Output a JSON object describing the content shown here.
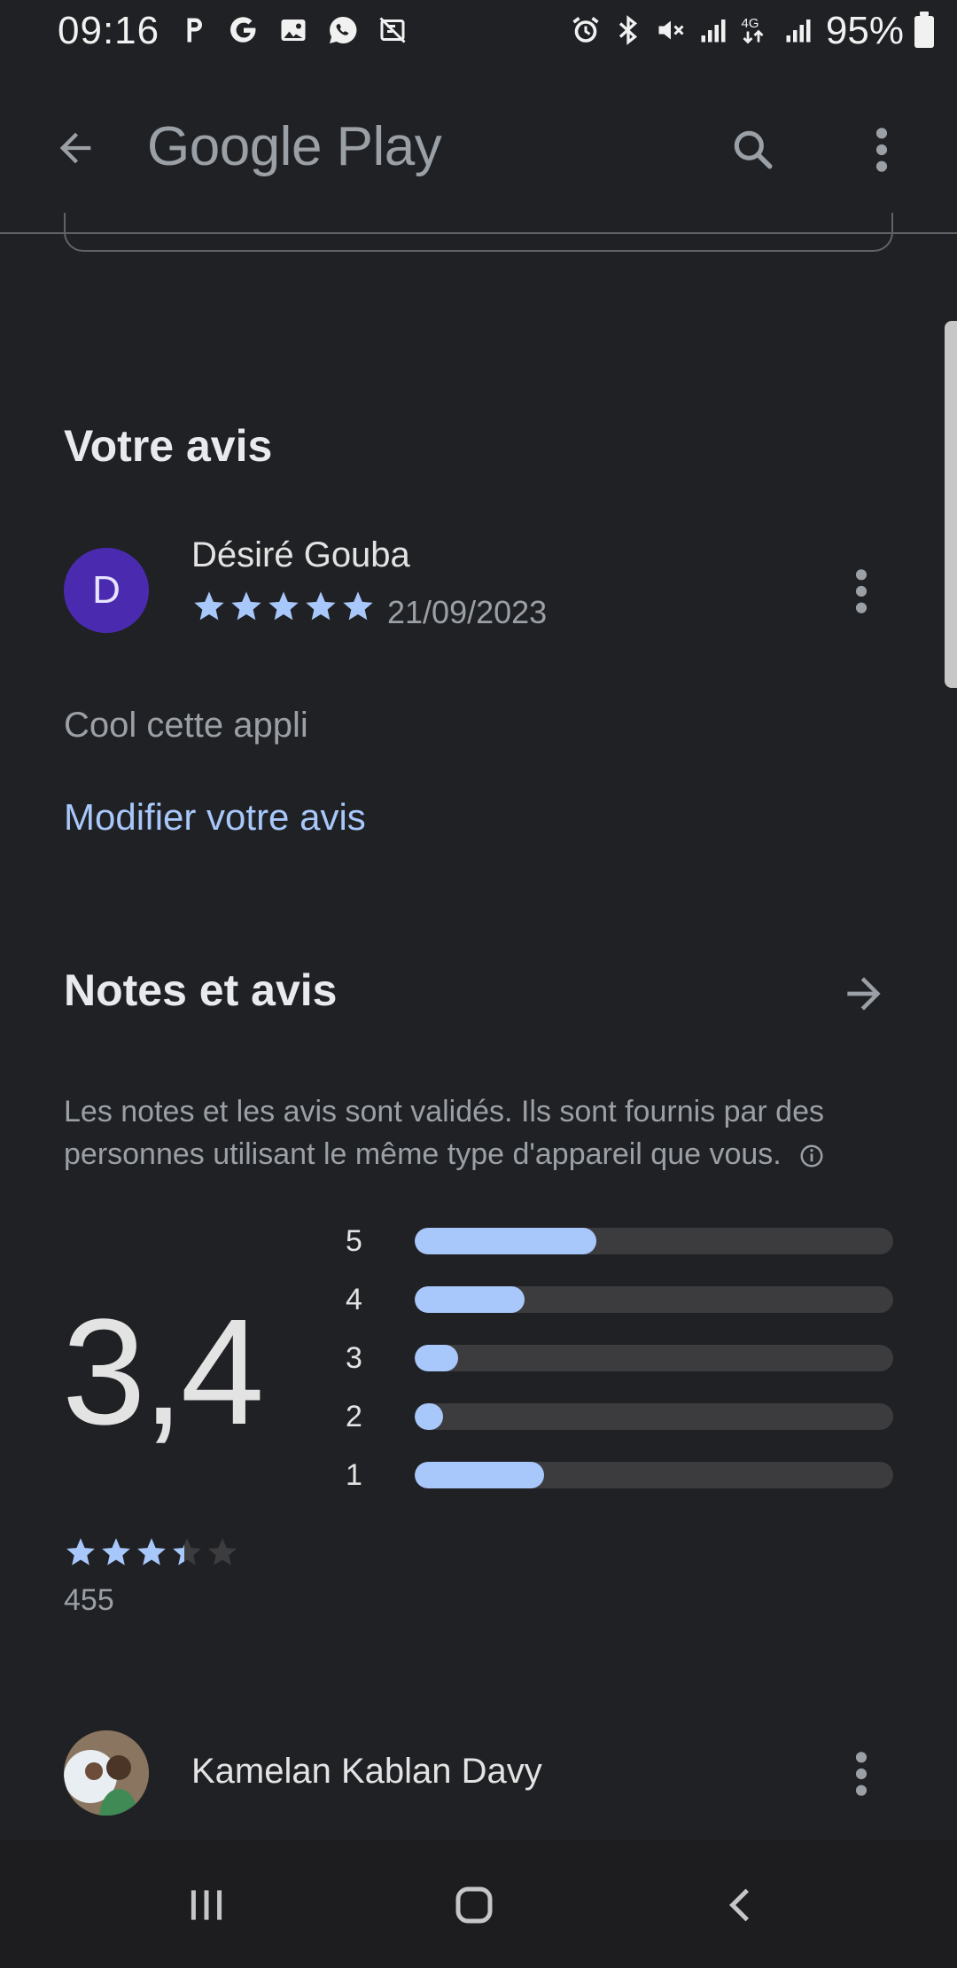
{
  "status_bar": {
    "time": "09:16",
    "network": "4G LTE",
    "battery": "95%"
  },
  "app_bar": {
    "title": "Google Play"
  },
  "your_review": {
    "section_title": "Votre avis",
    "avatar_letter": "D",
    "reviewer_name": "Désiré Gouba",
    "rating": 5,
    "date": "21/09/2023",
    "text": "Cool cette appli",
    "edit_label": "Modifier votre avis"
  },
  "ratings": {
    "section_title": "Notes et avis",
    "info_text": "Les notes et les avis sont validés. Ils sont fournis par des personnes utilisant le même type d'appareil que vous.",
    "average": "3,4",
    "average_value": 3.4,
    "count": "455",
    "distribution": [
      {
        "label": "5",
        "fraction": 0.38
      },
      {
        "label": "4",
        "fraction": 0.23
      },
      {
        "label": "3",
        "fraction": 0.09
      },
      {
        "label": "2",
        "fraction": 0.06
      },
      {
        "label": "1",
        "fraction": 0.27
      }
    ]
  },
  "next_review": {
    "reviewer_name": "Kamelan Kablan Davy"
  },
  "colors": {
    "background": "#202124",
    "accent": "#a8c7fa",
    "avatar": "#4a2bb0"
  }
}
